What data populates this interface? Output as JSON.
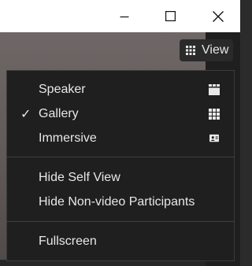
{
  "window_controls": {
    "minimize_icon": "minimize-icon",
    "maximize_icon": "maximize-icon",
    "close_icon": "close-icon"
  },
  "toolbar": {
    "view_label": "View",
    "view_icon": "grid-icon"
  },
  "view_menu": {
    "layouts": [
      {
        "label": "Speaker",
        "checked": false,
        "icon": "speaker-view-icon"
      },
      {
        "label": "Gallery",
        "checked": true,
        "icon": "gallery-view-icon"
      },
      {
        "label": "Immersive",
        "checked": false,
        "icon": "immersive-view-icon"
      }
    ],
    "check_glyph": "✓",
    "options": [
      {
        "label": "Hide Self View"
      },
      {
        "label": "Hide Non-video Participants"
      }
    ],
    "display": [
      {
        "label": "Fullscreen"
      }
    ]
  },
  "colors": {
    "menu_bg": "#1f1f1f",
    "menu_text": "#e8e8e8",
    "titlebar_bg": "#ffffff",
    "video_bg": "#6e6766"
  }
}
